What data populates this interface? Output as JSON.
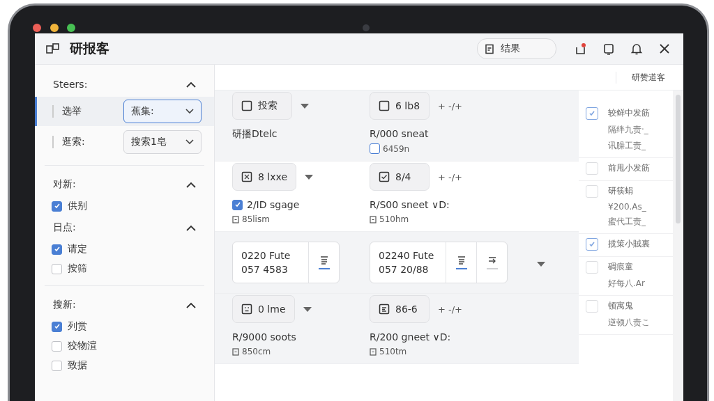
{
  "window": {
    "title": "研报客"
  },
  "header": {
    "result_button": "结果"
  },
  "toolbar": {
    "right_label": "研赞道客"
  },
  "sidebar": {
    "sections": [
      {
        "title": "Steers:",
        "expanded": true,
        "selects": [
          {
            "label": "选举",
            "value": "蕉集:",
            "selected": true
          },
          {
            "label": "逛索:",
            "value": "搜索1皂",
            "selected": false
          }
        ]
      },
      {
        "title": "对新:",
        "expanded": true,
        "options": [
          {
            "label": "供别",
            "checked": true
          }
        ]
      },
      {
        "title": "日点:",
        "expanded": true,
        "options": [
          {
            "label": "请定",
            "checked": true
          },
          {
            "label": "按筛",
            "checked": false
          }
        ]
      },
      {
        "title": "搜新:",
        "expanded": true,
        "options": [
          {
            "label": "列赏",
            "checked": true
          },
          {
            "label": "狡物渲",
            "checked": false
          },
          {
            "label": "致据",
            "checked": false
          }
        ]
      }
    ]
  },
  "rows": [
    {
      "kind": "product",
      "highlighted": true,
      "cells": [
        {
          "chip": "投索",
          "action": {
            "kind": "caret"
          },
          "title": "研播Dtelc"
        },
        {
          "chip": "6 lb8",
          "action": {
            "kind": "add",
            "label": "+ -/+"
          },
          "title": "R/000 sneat",
          "sub": "6459n",
          "sub_checked": false
        }
      ]
    },
    {
      "kind": "product",
      "highlighted": false,
      "cells": [
        {
          "chip": "8 lxxe",
          "action": {
            "kind": "caret"
          },
          "title": "2/ID sgage",
          "title_checked": true,
          "sub": "85lism"
        },
        {
          "chip": "8/4",
          "action": {
            "kind": "add",
            "label": "+ -/+"
          },
          "title": "R/S00 sneet ∨D:",
          "sub": "510hm"
        }
      ]
    },
    {
      "kind": "time",
      "highlighted": true,
      "cells": [
        {
          "line1": "0220 Fute",
          "line2": "057 4583",
          "tools": [
            {
              "selected": true
            }
          ]
        },
        {
          "line1": "02240 Fute",
          "line2": "057 20/88",
          "tools": [
            {
              "selected": true
            },
            {
              "selected": false
            }
          ]
        }
      ]
    },
    {
      "kind": "product",
      "highlighted": true,
      "cells": [
        {
          "chip": "0 lme",
          "action": {
            "kind": "caret"
          },
          "title": "R/9000 soots",
          "sub": "850cm"
        },
        {
          "chip": "86-6",
          "action": {
            "kind": "add",
            "label": "+ -/+"
          },
          "title": "R/200 gneet ∨D:",
          "sub": "510tm"
        }
      ]
    }
  ],
  "side_list": [
    {
      "title": "较鲜中发筋",
      "checked": true,
      "lines": [
        "隔绊九责·_",
        "讯臊工责_"
      ]
    },
    {
      "title": "前甩小发筋",
      "checked": false
    },
    {
      "title": "研筷蜎",
      "checked": false,
      "lines": [
        "¥200.As_",
        "蜜代工责_"
      ]
    },
    {
      "title": "揽策小賊裏",
      "checked": true
    },
    {
      "title": "碉痕童",
      "checked": false,
      "lines": [
        "好每八.Ar"
      ]
    },
    {
      "title": "顿寓鬼",
      "checked": false,
      "lines": [
        "逆顿八责こ"
      ]
    }
  ]
}
